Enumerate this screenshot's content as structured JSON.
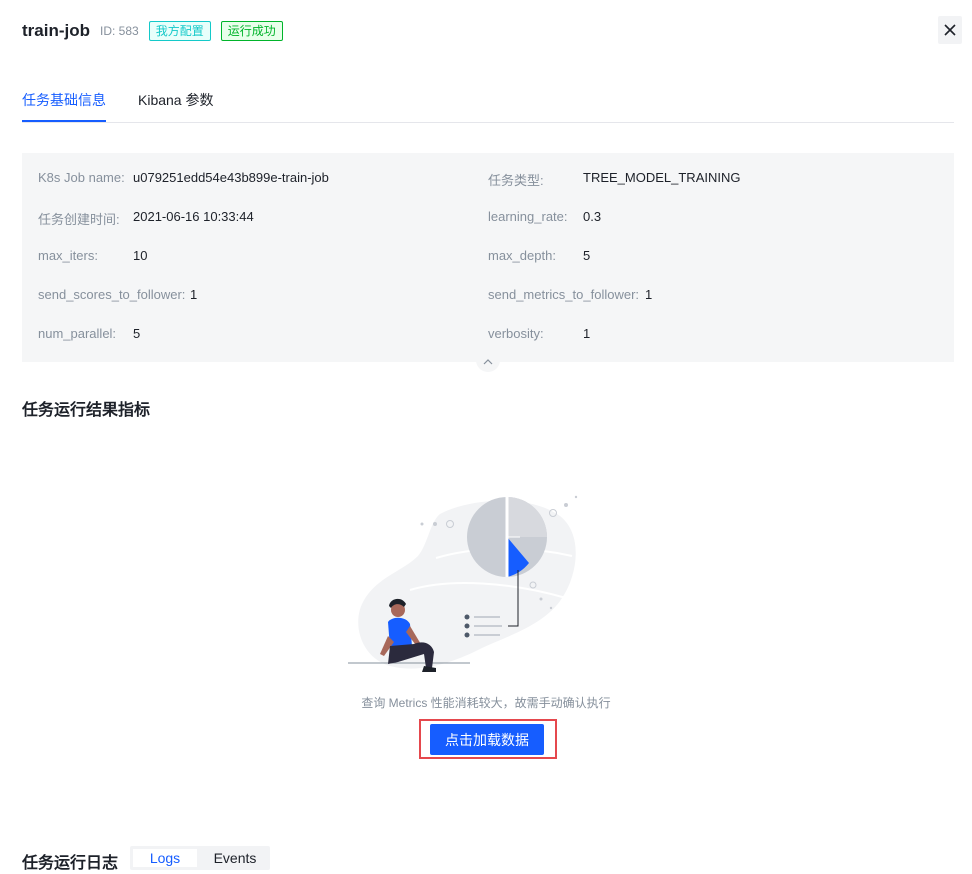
{
  "header": {
    "job_name": "train-job",
    "job_id": "ID: 583",
    "tag_config": "我方配置",
    "tag_status": "运行成功"
  },
  "tabs": [
    {
      "label": "任务基础信息",
      "active": true
    },
    {
      "label": "Kibana 参数",
      "active": false
    }
  ],
  "info": {
    "left": [
      {
        "label": "K8s Job name:",
        "value": "u079251edd54e43b899e-train-job"
      },
      {
        "label": "任务创建时间:",
        "value": "2021-06-16 10:33:44"
      },
      {
        "label": "max_iters:",
        "value": "10"
      },
      {
        "label": "send_scores_to_follower:",
        "value": "1"
      },
      {
        "label": "num_parallel:",
        "value": "5"
      }
    ],
    "right": [
      {
        "label": "任务类型:",
        "value": "TREE_MODEL_TRAINING"
      },
      {
        "label": "learning_rate:",
        "value": "0.3"
      },
      {
        "label": "max_depth:",
        "value": "5"
      },
      {
        "label": "send_metrics_to_follower:",
        "value": "1"
      },
      {
        "label": "verbosity:",
        "value": "1"
      }
    ]
  },
  "metrics": {
    "title": "任务运行结果指标",
    "empty_text": "查询 Metrics 性能消耗较大，故需手动确认执行",
    "load_button": "点击加载数据"
  },
  "logs": {
    "title": "任务运行日志",
    "tabs": [
      {
        "label": "Logs",
        "active": true
      },
      {
        "label": "Events",
        "active": false
      }
    ]
  },
  "colors": {
    "primary": "#165dff",
    "tag_cyan": "#14c9c9",
    "tag_green": "#00b42a",
    "highlight_border": "#e5484d"
  },
  "icons": {
    "close": "close-icon",
    "collapse": "chevron-up-icon"
  }
}
